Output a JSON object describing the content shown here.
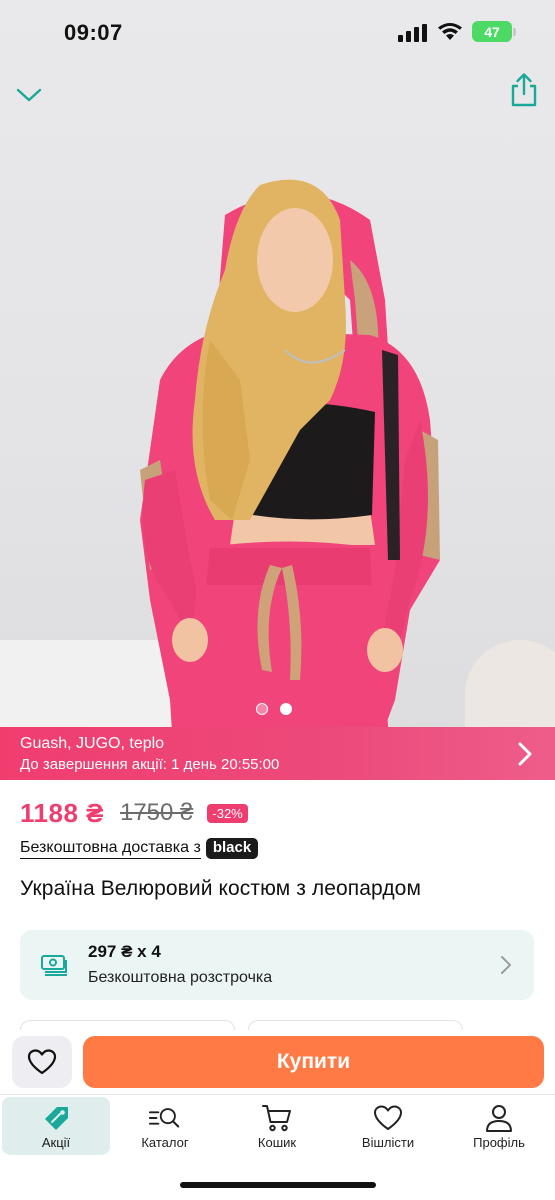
{
  "status_bar": {
    "time": "09:07",
    "battery": "47"
  },
  "gallery": {
    "slide_count": 2,
    "active_slide": 2
  },
  "promo": {
    "name": "Guash, JUGO, teplo",
    "timer": "До завершення акції: 1 день 20:55:00"
  },
  "price": {
    "current": "1188 ₴",
    "old": "1750 ₴",
    "discount": "-32%"
  },
  "delivery": {
    "text": "Безкоштовна доставка з",
    "badge": "black"
  },
  "product": {
    "title": "Україна Велюровий костюм з леопардом"
  },
  "installment": {
    "amount": "297 ₴ x 4",
    "label": "Безкоштовна розстрочка"
  },
  "buy_bar": {
    "buy_label": "Купити"
  },
  "tabs": [
    {
      "label": "Акції",
      "icon": "tag-icon",
      "active": true
    },
    {
      "label": "Каталог",
      "icon": "catalog-search-icon",
      "active": false
    },
    {
      "label": "Кошик",
      "icon": "cart-icon",
      "active": false
    },
    {
      "label": "Вішлісти",
      "icon": "heart-icon",
      "active": false
    },
    {
      "label": "Профіль",
      "icon": "user-icon",
      "active": false
    }
  ],
  "colors": {
    "accent_pink": "#f03d6f",
    "buy_orange": "#ff7a45",
    "teal": "#1aa89a",
    "installment_bg": "#ebf6f4"
  }
}
